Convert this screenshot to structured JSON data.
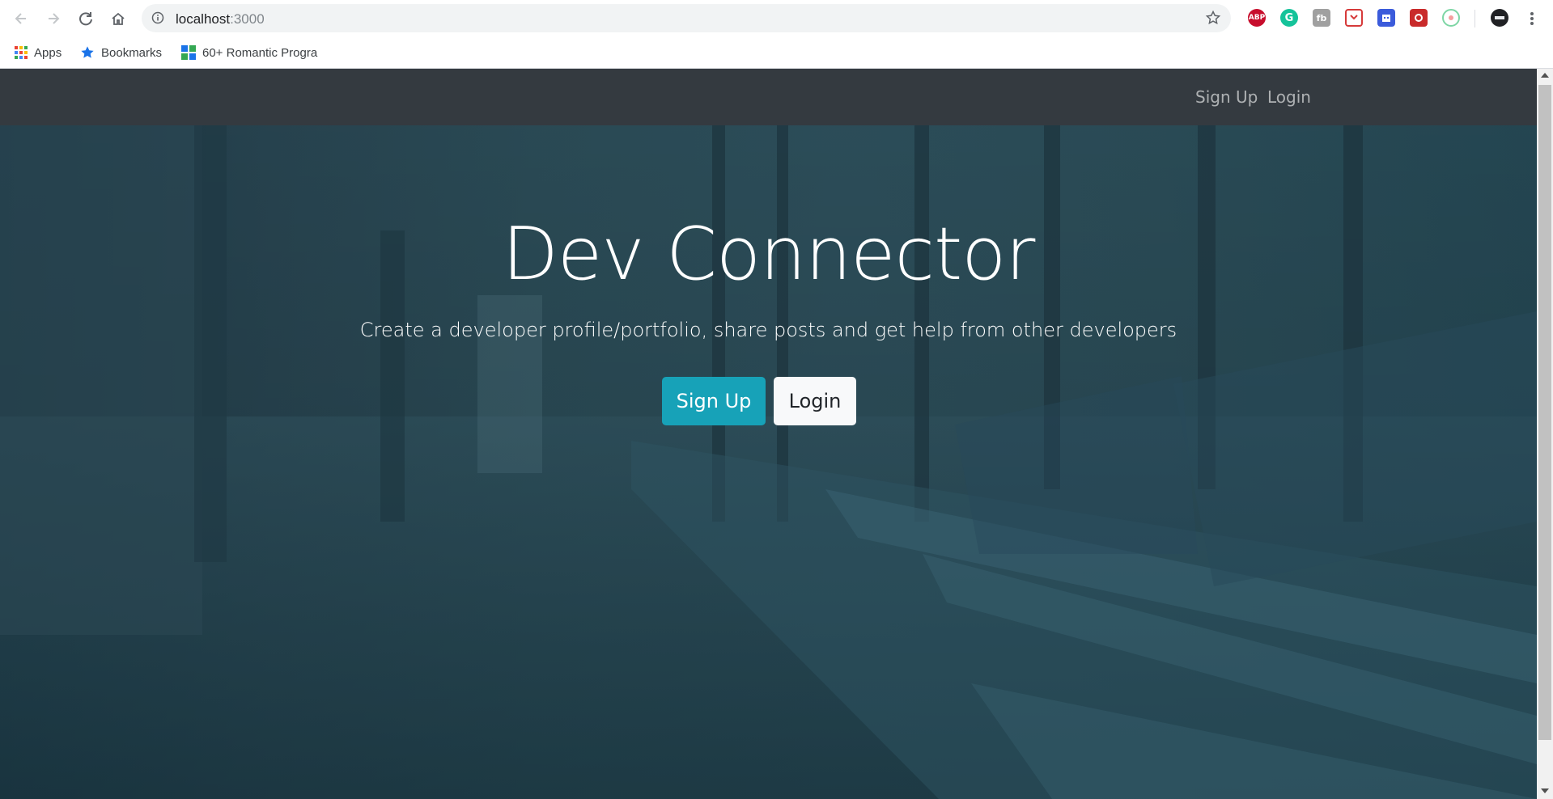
{
  "browser": {
    "url_host": "localhost",
    "url_port": ":3000",
    "bookmarks": [
      {
        "label": "Apps",
        "icon": "apps-grid-icon"
      },
      {
        "label": "Bookmarks",
        "icon": "star-icon"
      },
      {
        "label": "60+ Romantic Progra",
        "icon": "grid-bookmark-icon"
      }
    ],
    "extensions": [
      {
        "label": "ABP",
        "color": "#c70d2c"
      },
      {
        "label": "G",
        "color": "#15c39a"
      },
      {
        "label": "fb",
        "color": "#a0a0a0"
      },
      {
        "label": "",
        "color": "#d63a3a"
      },
      {
        "label": "",
        "color": "#3b5bdb"
      },
      {
        "label": "",
        "color": "#c92a2a"
      },
      {
        "label": "",
        "color": "#7ed6a5"
      }
    ]
  },
  "navbar": {
    "signup_label": "Sign Up",
    "login_label": "Login"
  },
  "hero": {
    "title": "Dev Connector",
    "lead": "Create a developer profile/portfolio, share posts and get help from other developers",
    "signup_label": "Sign Up",
    "login_label": "Login"
  },
  "colors": {
    "navbar_bg": "#343a40",
    "primary": "#17a2b8",
    "light": "#f8f9fa"
  }
}
